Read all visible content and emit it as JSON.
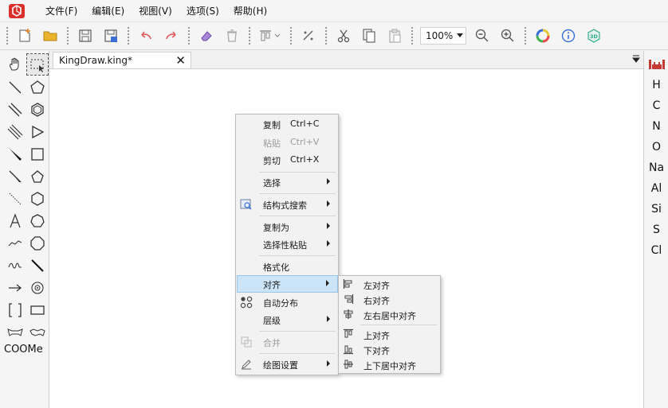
{
  "menubar": {
    "items": [
      "文件(F)",
      "编辑(E)",
      "视图(V)",
      "选项(S)",
      "帮助(H)"
    ]
  },
  "toolbar": {
    "zoom_value": "100%"
  },
  "left_palette": {
    "text_tool_label": "COOMe"
  },
  "tab": {
    "title": "KingDraw.king*",
    "close": "✕"
  },
  "elements": [
    "H",
    "C",
    "N",
    "O",
    "Na",
    "Al",
    "Si",
    "S",
    "Cl"
  ],
  "context_menu": {
    "copy": "复制",
    "copy_shortcut": "Ctrl+C",
    "paste": "粘贴",
    "paste_shortcut": "Ctrl+V",
    "cut": "剪切",
    "cut_shortcut": "Ctrl+X",
    "select": "选择",
    "structure_search": "结构式搜索",
    "copy_as": "复制为",
    "paste_special": "选择性粘贴",
    "format": "格式化",
    "align": "对齐",
    "auto_distribute": "自动分布",
    "layer": "层级",
    "merge": "合并",
    "drawing_settings": "绘图设置"
  },
  "align_submenu": {
    "left": "左对齐",
    "right": "右对齐",
    "center_h": "左右居中对齐",
    "top": "上对齐",
    "bottom": "下对齐",
    "center_v": "上下居中对齐"
  },
  "colors": {
    "logo": "#d9302b",
    "undo": "#e05a5a",
    "accent_blue": "#3b6fd8",
    "highlight": "#cce4f7"
  }
}
